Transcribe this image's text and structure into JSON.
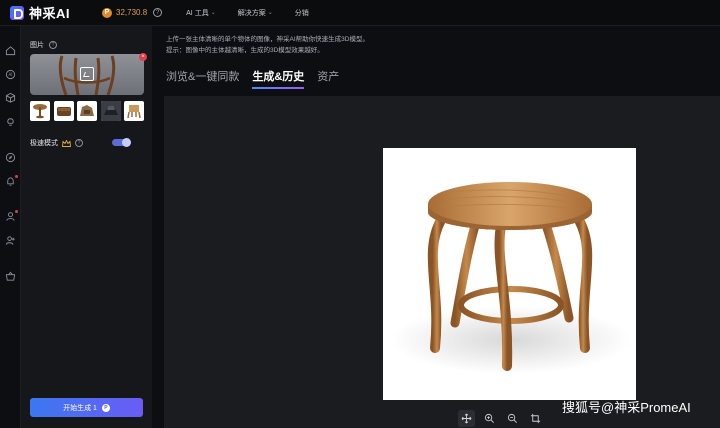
{
  "app": {
    "logo_text": "神采AI",
    "credits": "32,730.8"
  },
  "nav": [
    {
      "label": "AI 工具",
      "has_chevron": true
    },
    {
      "label": "解决方案",
      "has_chevron": true
    },
    {
      "label": "分销",
      "has_chevron": false
    }
  ],
  "rail_icons": [
    "home-icon",
    "ai-icon",
    "cube-icon",
    "bulb-icon",
    "compass-icon",
    "bell-icon",
    "user-icon",
    "user-plus-icon",
    "shop-icon"
  ],
  "panel": {
    "image_label": "图片",
    "speed_label": "极速模式",
    "speed_enabled": true,
    "generate_label": "开始生成 1"
  },
  "main": {
    "hint_line1": "上传一张主体清晰的单个物体的图像，神采AI帮助你快速生成3D模型。",
    "hint_line2": "提示：图像中的主体越清晰，生成的3D模型效果越好。",
    "tabs": [
      {
        "label": "浏览&一键同款",
        "active": false
      },
      {
        "label": "生成&历史",
        "active": true
      },
      {
        "label": "资产",
        "active": false
      }
    ],
    "tools": [
      "move-icon",
      "zoom-in-icon",
      "zoom-out-icon",
      "crop-icon"
    ],
    "watermark": "搜狐号@神采PromeAI"
  },
  "colors": {
    "accent_blue": "#3b78f0",
    "accent_purple": "#6a5cf5",
    "credits_orange": "#d9a050",
    "alert_red": "#e23d4a"
  }
}
